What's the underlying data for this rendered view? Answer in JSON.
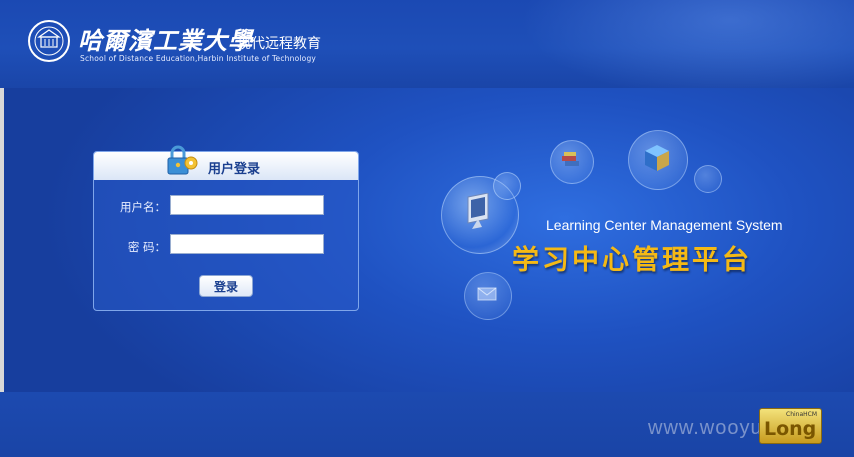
{
  "header": {
    "university_name": "哈爾濱工業大學",
    "subtitle": "现代远程教育",
    "english_name": "School of Distance Education,Harbin Institute of Technology"
  },
  "login": {
    "title": "用户登录",
    "username_label": "用户名：",
    "password_label": "密 码：",
    "username_value": "",
    "password_value": "",
    "submit_label": "登录"
  },
  "system": {
    "english_title": "Learning Center Management System",
    "chinese_title": "学习中心管理平台"
  },
  "footer": {
    "watermark": "www.wooyun.org",
    "badge_small": "ChinaHCM",
    "badge_big": "Long"
  },
  "colors": {
    "background": "#1b3e9a",
    "accent_gold": "#f5b915",
    "login_title": "#1a3f8f"
  }
}
